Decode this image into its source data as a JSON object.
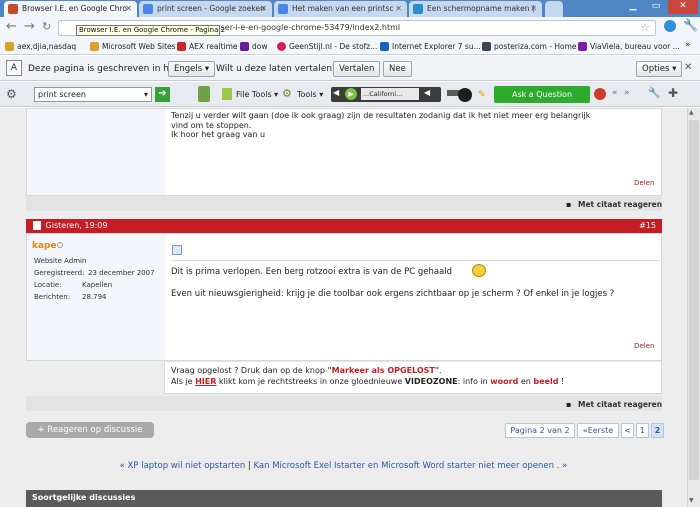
{
  "tabs": [
    {
      "label": "Browser I.E. en Google Chro",
      "color": "#c24e2a",
      "active": true
    },
    {
      "label": "print screen - Google zoeken",
      "color": "#4a86e8",
      "active": false
    },
    {
      "label": "Het maken van een printsc",
      "color": "#4a86e8",
      "active": false
    },
    {
      "label": "Een schermopname maken (",
      "color": "#2a8dd4",
      "active": false
    }
  ],
  "tooltip": "Browser I.E. en Google Chrome - Pagina 2",
  "address": {
    "url": "...ser-i-e-en-google-chrome-53479/index2.html"
  },
  "bookmarks": [
    {
      "label": "aex,djia,nasdaq",
      "color": "#a77b3a"
    },
    {
      "label": "Microsoft Web Sites",
      "color": "#d8a22c"
    },
    {
      "label": "AEX realtime",
      "color": "#c62828"
    },
    {
      "label": "dow",
      "color": "#6a1b9a"
    },
    {
      "label": "GeenStijl.nl - De stofz...",
      "color": "#d81b60"
    },
    {
      "label": "Internet Explorer 7 su...",
      "color": "#1565c0"
    },
    {
      "label": "posteriza.com - Home",
      "color": "#37474f"
    },
    {
      "label": "ViaViela, bureau voor ...",
      "color": "#7b1fa2"
    }
  ],
  "translate": {
    "prefix": "Deze pagina is geschreven in het",
    "language": "Engels",
    "question": "Wilt u deze laten vertalen?",
    "translate_label": "Vertalen",
    "no_label": "Nee",
    "options_label": "Opties"
  },
  "toolbar": {
    "search_value": "print screen",
    "file_tools": "File Tools",
    "tools": "Tools",
    "radio": "...Californi...",
    "ask": "Ask a Question"
  },
  "post1": {
    "lines": [
      "Tenzij u verder wilt gaan (doe ik ook graag) zijn de resultaten zodanig dat ik het niet meer erg belangrijk",
      "vind om te stoppen.",
      "Ik hoor het graag van u"
    ],
    "delen": "Delen",
    "quote": "Met citaat reageren"
  },
  "post2": {
    "date": "Gisteren, 19:09",
    "number": "#15",
    "username": "kape",
    "role": "Website Admin",
    "fields": [
      {
        "label": "Geregistreerd:",
        "value": "23 december 2007"
      },
      {
        "label": "Locatie:",
        "value": "Kapellen"
      },
      {
        "label": "Berichten:",
        "value": "28.794"
      }
    ],
    "msg1": "Dit is prima verlopen. Een berg rotzooi extra is van de PC gehaald",
    "msg2": "Even uit nieuwsgierigheid: krijg je die toolbar ook ergens zichtbaar op je scherm ? Of enkel in je logjes ?",
    "delen": "Delen",
    "sig1_pre": "Vraag opgelost ? Druk dan op de knop ",
    "sig1_bold": "\"Markeer als OPGELOST\"",
    "sig1_post": ".",
    "sig2_a": "Als je ",
    "sig2_hier": "HIER",
    "sig2_b": " klikt kom je rechtstreeks in onze gloednieuwe ",
    "sig2_vz": "VIDEOZONE",
    "sig2_c": ": info in ",
    "sig2_woord": "woord",
    "sig2_d": " en ",
    "sig2_beeld": "beeld",
    "sig2_e": " !",
    "quote": "Met citaat reageren"
  },
  "reply_button": "+ Reageren op discussie",
  "pagination": {
    "label": "Pagina 2 van 2",
    "first": "«Eerste",
    "prev": "<",
    "p1": "1",
    "p2": "2"
  },
  "related_nav": {
    "prev": "« XP laptop wil niet opstarten",
    "sep": " | ",
    "next": "Kan Microsoft Exel Istarter en Microsoft Word starter niet meer openen . »"
  },
  "similar_header": "Soortgelijke discussies"
}
